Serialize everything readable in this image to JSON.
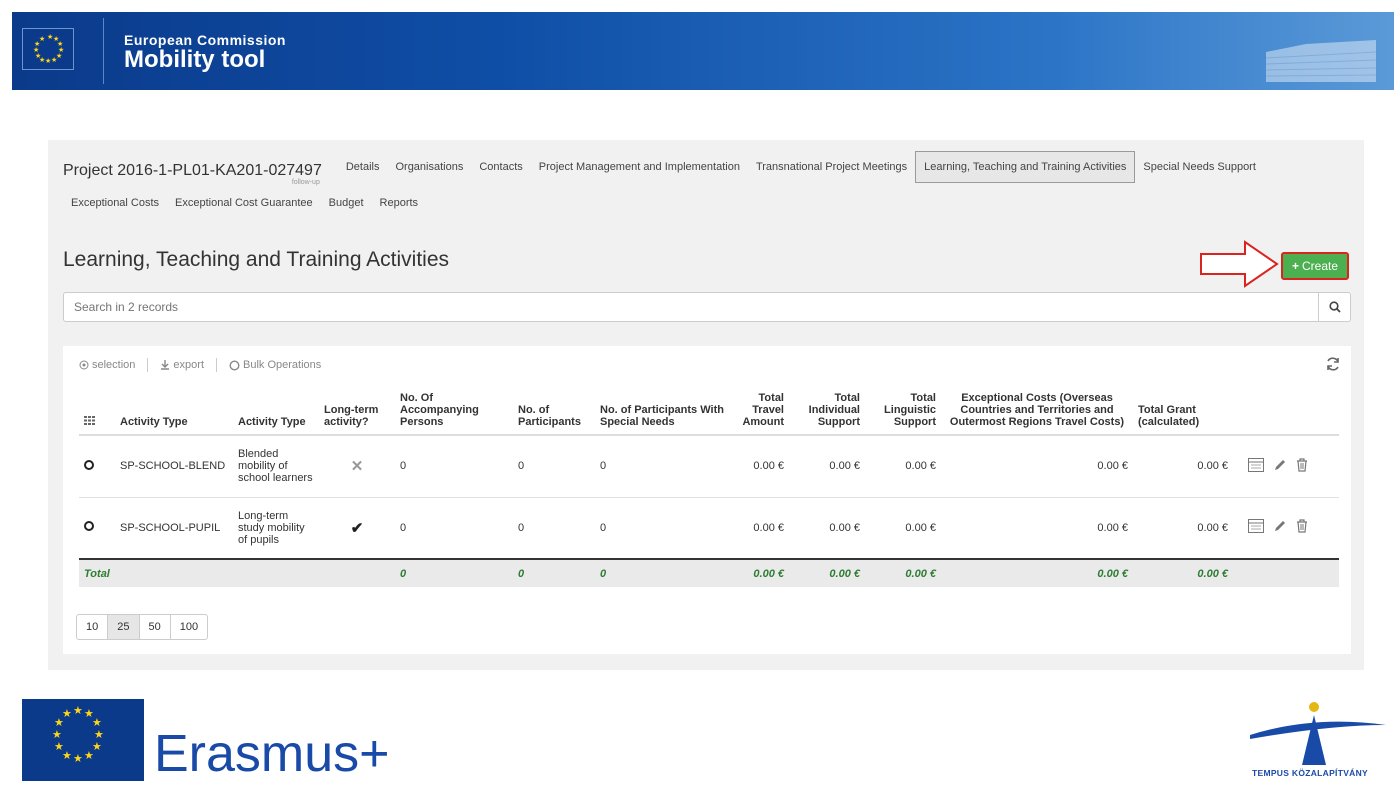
{
  "banner": {
    "line1": "European Commission",
    "line2": "Mobility tool"
  },
  "project": {
    "title": "Project 2016-1-PL01-KA201-027497",
    "subtitle": "follow-up"
  },
  "tabs": [
    "Details",
    "Organisations",
    "Contacts",
    "Project Management and Implementation",
    "Transnational Project Meetings",
    "Learning, Teaching and Training Activities",
    "Special Needs Support",
    "Exceptional Costs",
    "Exceptional Cost Guarantee",
    "Budget",
    "Reports"
  ],
  "active_tab": "Learning, Teaching and Training Activities",
  "heading": "Learning, Teaching and Training Activities",
  "create_label": "Create",
  "search": {
    "placeholder": "Search in 2 records"
  },
  "toolbar": {
    "selection": "selection",
    "export": "export",
    "bulk": "Bulk Operations"
  },
  "table": {
    "headers": [
      "Activity Type",
      "Activity Type",
      "Long-term activity?",
      "No. Of Accompanying Persons",
      "No. of Participants",
      "No. of Participants With Special Needs",
      "Total Travel Amount",
      "Total Individual Support",
      "Total Linguistic Support",
      "Exceptional Costs (Overseas Countries and Territories and Outermost Regions Travel Costs)",
      "Total Grant (calculated)"
    ],
    "rows": [
      {
        "code": "SP-SCHOOL-BLEND",
        "desc": "Blended mobility of school learners",
        "longterm": "no",
        "accompanying": "0",
        "participants": "0",
        "special": "0",
        "travel": "0.00 €",
        "individual": "0.00 €",
        "linguistic": "0.00 €",
        "exceptional": "0.00 €",
        "grant": "0.00 €"
      },
      {
        "code": "SP-SCHOOL-PUPIL",
        "desc": "Long-term study mobility of pupils",
        "longterm": "yes",
        "accompanying": "0",
        "participants": "0",
        "special": "0",
        "travel": "0.00 €",
        "individual": "0.00 €",
        "linguistic": "0.00 €",
        "exceptional": "0.00 €",
        "grant": "0.00 €"
      }
    ],
    "total": {
      "label": "Total",
      "accompanying": "0",
      "participants": "0",
      "special": "0",
      "travel": "0.00 €",
      "individual": "0.00 €",
      "linguistic": "0.00 €",
      "exceptional": "0.00 €",
      "grant": "0.00 €"
    }
  },
  "pagination": [
    "10",
    "25",
    "50",
    "100"
  ],
  "pagination_selected": "25",
  "footer": {
    "erasmus": "Erasmus+",
    "tempus": "TEMPUS KÖZALAPÍTVÁNY"
  },
  "colors": {
    "brand_blue": "#0b3a8a",
    "create_green": "#4caf50",
    "highlight_red": "#d9241f",
    "total_green": "#2e7d32"
  }
}
